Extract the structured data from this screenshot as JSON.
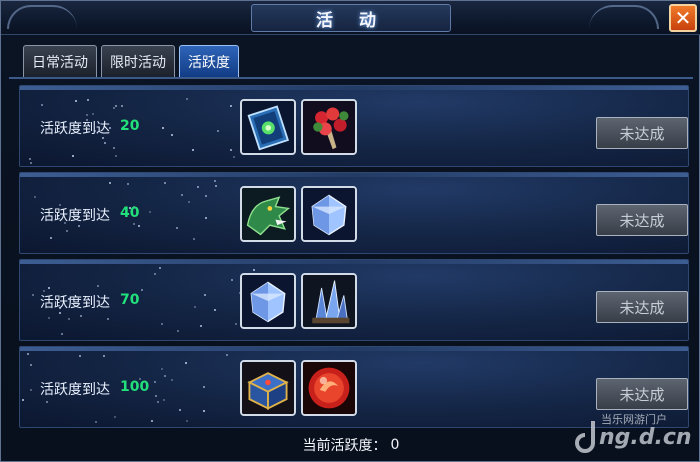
{
  "window": {
    "title": "活 动",
    "close_glyph": "✕"
  },
  "tabs": [
    {
      "label": "日常活动",
      "active": false
    },
    {
      "label": "限时活动",
      "active": false
    },
    {
      "label": "活跃度",
      "active": true
    }
  ],
  "rows": [
    {
      "label": "活跃度到达",
      "value": "20",
      "rewards": [
        "spellbook-icon",
        "flower-bouquet-icon"
      ],
      "status": "未达成"
    },
    {
      "label": "活跃度到达",
      "value": "40",
      "rewards": [
        "dragon-head-icon",
        "crystal-icon"
      ],
      "status": "未达成"
    },
    {
      "label": "活跃度到达",
      "value": "70",
      "rewards": [
        "crystal-icon",
        "blue-crystal-cluster-icon"
      ],
      "status": "未达成"
    },
    {
      "label": "活跃度到达",
      "value": "100",
      "rewards": [
        "treasure-chest-icon",
        "red-orb-icon"
      ],
      "status": "未达成"
    }
  ],
  "footer": {
    "label": "当前活跃度：",
    "value": "0"
  },
  "watermark": {
    "top": "当乐网游门户",
    "main": "ng.d.cn"
  },
  "colors": {
    "value_green": "#22e07a",
    "tab_active": "#2e64b8",
    "close_orange": "#e0601c"
  }
}
